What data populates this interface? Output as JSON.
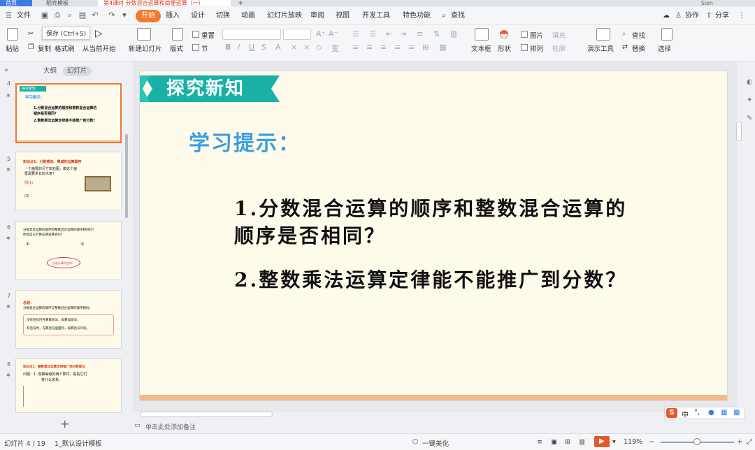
{
  "tabs": {
    "home": "首页",
    "template": "稻壳模板",
    "document": "第4课时 分数混合运算和简便运算（一）",
    "add": "+",
    "user": "Sion"
  },
  "menu": {
    "file": "文件",
    "items": [
      "开始",
      "插入",
      "设计",
      "切换",
      "动画",
      "幻灯片放映",
      "审阅",
      "视图",
      "开发工具",
      "特色功能"
    ],
    "search": "查找",
    "collab": "协作",
    "share": "分享"
  },
  "tooltip": "保存 (Ctrl+S)",
  "ribbon": {
    "paste": "粘贴",
    "cut": "剪切",
    "copy": "复制",
    "format_painter": "格式刷",
    "from_current": "从当前开始",
    "new_slide": "新建幻灯片",
    "layout": "版式",
    "section": "节",
    "reset": "重置",
    "textbox": "文本框",
    "shape": "形状",
    "arrange": "排列",
    "outline": "轮廓",
    "picture": "图片",
    "fill": "填充",
    "present_tools": "演示工具",
    "find": "查找",
    "replace": "替换",
    "select": "选择"
  },
  "panel": {
    "outline_tab": "大纲",
    "slides_tab": "幻灯片",
    "slides": [
      {
        "num": "4",
        "lines": [
          "探究新知",
          "学习提示：",
          "1.分数混合运算的顺序和整数混合运算的",
          "顺序是否相同？",
          "2.整数乘法运算定律能不能推广到分数？"
        ]
      },
      {
        "num": "5",
        "lines": [
          "知识点1：分数乘加、乘减的运算顺序",
          "一个画框的尺寸如右图，做这个画",
          "框需要多长的木条？",
          "例(1)",
          "(2)"
        ]
      },
      {
        "num": "6",
        "lines": [
          "分数混合运算的顺序和整数混合运算的顺序相同吗？",
          "你会自己计算这两道算式吗？",
          "①",
          "②",
          "这道计算你会吗？"
        ]
      },
      {
        "num": "7",
        "lines": [
          "总结：",
          "分数混合运算的顺序与整数混合运算的顺序相同。",
          "没有括号时先算乘除法，再算加减法；",
          "有括号时，先算括号里面的，再算括号外的。"
        ]
      },
      {
        "num": "8",
        "lines": [
          "知识点2：整数乘法运算定律推广到分数乘法",
          "问题：1. 观察每组的两个算式，看看它们",
          "有什么关系。"
        ]
      }
    ]
  },
  "slide": {
    "banner": "探究新知",
    "hint": "学习提示：",
    "q1_line1": "1.分数混合运算的顺序和整数混合运算的",
    "q1_line2": "顺序是否相同？",
    "q2": "2.整数乘法运算定律能不能推广到分数？"
  },
  "notes_placeholder": "单击此处添加备注",
  "ime": {
    "lang": "中",
    "dot": "°,"
  },
  "status": {
    "slide_index": "幻灯片 4 / 19",
    "theme": "1_默认设计模板",
    "beautify": "一键美化",
    "zoom": "119%"
  },
  "colors": {
    "accent": "#f07a2e",
    "banner": "#1ab0a8",
    "hint": "#3a9ee3",
    "slide_bg": "#fffbea"
  }
}
